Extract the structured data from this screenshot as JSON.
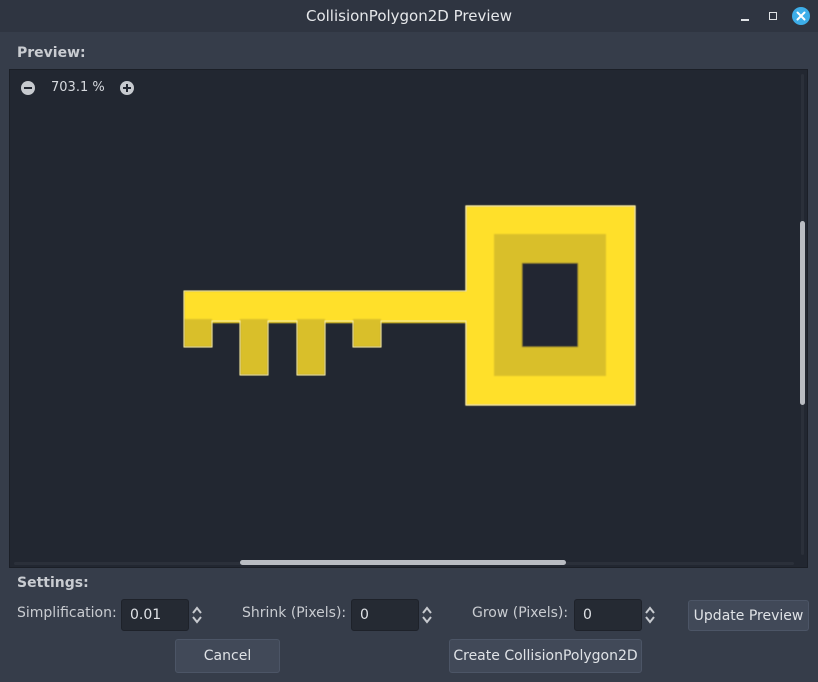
{
  "window": {
    "title": "CollisionPolygon2D Preview"
  },
  "preview": {
    "label": "Preview:",
    "zoom": "703.1 %"
  },
  "settings": {
    "label": "Settings:",
    "simplification": {
      "label": "Simplification:",
      "value": "0.01"
    },
    "shrink": {
      "label": "Shrink (Pixels):",
      "value": "0"
    },
    "grow": {
      "label": "Grow (Pixels):",
      "value": "0"
    },
    "update_label": "Update Preview"
  },
  "footer": {
    "cancel_label": "Cancel",
    "create_label": "Create CollisionPolygon2D"
  },
  "colors": {
    "key_fill": "#ffe02a",
    "key_shade": "#d9bf2a",
    "accent": "#3daee9"
  },
  "icons": {
    "zoom_out": "minus-circle-icon",
    "zoom_in": "plus-circle-icon",
    "minimize": "minimize-icon",
    "maximize": "maximize-icon",
    "close": "close-icon",
    "spin": "up-down-arrows-icon"
  }
}
